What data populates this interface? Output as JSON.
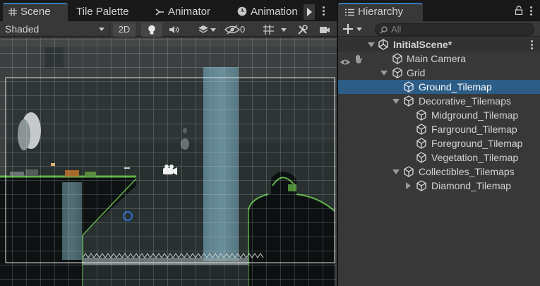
{
  "scene_panel": {
    "tabs": [
      {
        "label": "Scene",
        "icon": "grid-icon",
        "active": true
      },
      {
        "label": "Tile Palette",
        "icon": "",
        "active": false
      },
      {
        "label": "Animator",
        "icon": "animator-icon",
        "active": false
      },
      {
        "label": "Animation",
        "icon": "clock-icon",
        "active": false
      }
    ],
    "toolbar": {
      "shading_mode": "Shaded",
      "mode_2d": "2D",
      "hidden_count": "0"
    }
  },
  "hierarchy": {
    "tab_label": "Hierarchy",
    "search_placeholder": "All",
    "scene_name": "InitialScene*",
    "items": [
      {
        "label": "Main Camera"
      },
      {
        "label": "Grid"
      },
      {
        "label": "Ground_Tilemap",
        "selected": true
      },
      {
        "label": "Decorative_Tilemaps"
      },
      {
        "label": "Midground_Tilemap"
      },
      {
        "label": "Farground_Tilemap"
      },
      {
        "label": "Foreground_Tilemap"
      },
      {
        "label": "Vegetation_Tilemap"
      },
      {
        "label": "Collectibles_Tilemaps"
      },
      {
        "label": "Diamond_Tilemap"
      }
    ]
  },
  "colors": {
    "accent": "#3a79bb",
    "selection": "#2c5d87",
    "panel_bg": "#383838",
    "tab_bg": "#191919",
    "grass": "#5fb34a",
    "waterfall": "#5a7e8c"
  }
}
